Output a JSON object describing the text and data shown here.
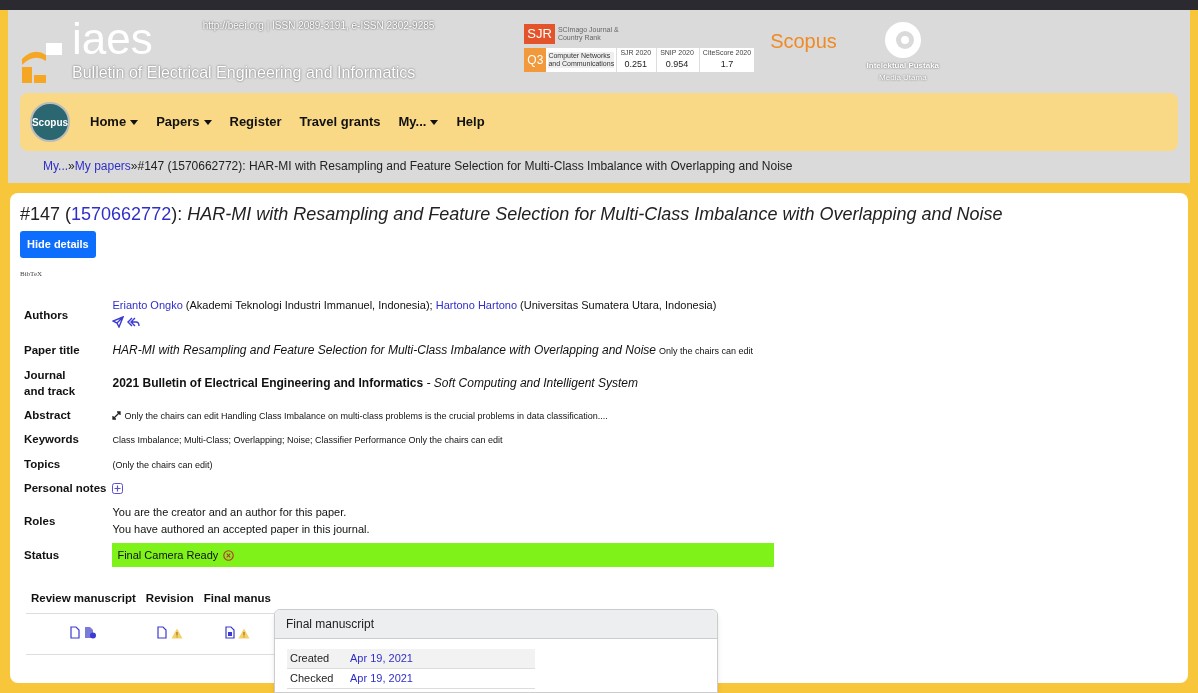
{
  "header": {
    "logo_text": "iaes",
    "url_issn": "http://beei.org  | ISSN 2089-3191, e-ISSN 2302-9285",
    "journal_name": "Bulletin of Electrical Engineering and Informatics",
    "sjr": {
      "label": "SJR",
      "caption": "SCImago Journal & Country Rank",
      "quartile": "Q3",
      "category": "Computer Networks and Communications",
      "metrics": [
        {
          "label": "SJR 2020",
          "value": "0.251"
        },
        {
          "label": "SNIP 2020",
          "value": "0.954"
        },
        {
          "label": "CiteScore 2020",
          "value": "1.7"
        }
      ]
    },
    "scopus": "Scopus",
    "publisher": {
      "name": "Intelektual Pustaka",
      "tagline": "Media Utama"
    }
  },
  "nav": {
    "badge": "Scopus",
    "items": [
      {
        "label": "Home",
        "dropdown": true
      },
      {
        "label": "Papers",
        "dropdown": true
      },
      {
        "label": "Register",
        "dropdown": false
      },
      {
        "label": "Travel grants",
        "dropdown": false
      },
      {
        "label": "My...",
        "dropdown": true
      },
      {
        "label": "Help",
        "dropdown": false
      }
    ]
  },
  "breadcrumb": {
    "separator": "»",
    "links": [
      "My...",
      "My papers"
    ],
    "current": "#147 (1570662772): HAR-MI with Resampling and Feature Selection for Multi-Class Imbalance with Overlapping and Noise"
  },
  "heading": {
    "prefix": "#147 (",
    "id": "1570662772",
    "suffix": "): ",
    "title": "HAR-MI with Resampling and Feature Selection for Multi-Class Imbalance with Overlapping and Noise"
  },
  "hide_button": "Hide details",
  "bibtex": "BibTeX",
  "details": [
    {
      "kind": "authors",
      "label": "Authors",
      "authors": [
        {
          "name": "Erianto Ongko",
          "affiliation": " (Akademi Teknologi Industri Immanuel, Indonesia); "
        },
        {
          "name": "Hartono Hartono",
          "affiliation": " (Universitas Sumatera Utara, Indonesia)"
        }
      ]
    },
    {
      "kind": "title",
      "label": "Paper title",
      "value": "HAR-MI with Resampling and Feature Selection for Multi-Class Imbalance with Overlapping and Noise",
      "note": "Only the chairs can edit"
    },
    {
      "kind": "journal",
      "label": "Journal and track",
      "value": "2021 Bulletin of Electrical Engineering and Informatics",
      "track": " - Soft Computing and Intelligent System"
    },
    {
      "kind": "abstract",
      "label": "Abstract",
      "value": "Only the chairs can edit Handling Class Imbalance on multi-class problems is the crucial problems in data classification...."
    },
    {
      "kind": "small",
      "label": "Keywords",
      "value": "Class Imbalance; Multi-Class; Overlapping; Noise; Classifier Performance Only the chairs can edit"
    },
    {
      "kind": "small",
      "label": "Topics",
      "value": "(Only the chairs can edit)"
    },
    {
      "kind": "notes",
      "label": "Personal notes"
    },
    {
      "kind": "lines",
      "label": "Roles",
      "lines": [
        "You are the creator and an author for this paper.",
        "You have authored an accepted paper in this journal."
      ]
    },
    {
      "kind": "status",
      "label": "Status",
      "value": "Final Camera Ready"
    }
  ],
  "manuscripts": {
    "columns": [
      "Review manuscript",
      "Revision",
      "Final manus"
    ],
    "cells": [
      {
        "icons": [
          {
            "kind": "pdf"
          },
          {
            "kind": "info"
          }
        ]
      },
      {
        "icons": [
          {
            "kind": "pdf"
          },
          {
            "kind": "warning"
          }
        ]
      },
      {
        "icons": [
          {
            "kind": "doc"
          },
          {
            "kind": "warning"
          }
        ]
      }
    ]
  },
  "popover": {
    "title": "Final manuscript",
    "rows": [
      {
        "label": "Created",
        "value": "Apr 19, 2021"
      },
      {
        "label": "Checked",
        "value": "Apr 19, 2021"
      }
    ]
  }
}
